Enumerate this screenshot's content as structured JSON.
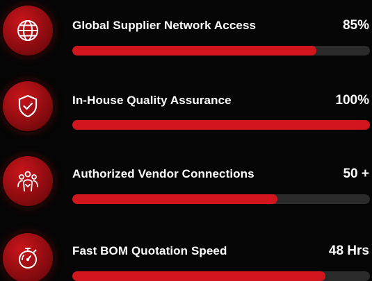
{
  "colors": {
    "accent": "#d0161c",
    "track": "#2a2a2a",
    "background": "#050505",
    "text": "#ffffff"
  },
  "metrics": [
    {
      "label": "Global Supplier Network Access",
      "value": "85%",
      "progress": 0.82,
      "icon": "globe-icon"
    },
    {
      "label": "In-House Quality Assurance",
      "value": "100%",
      "progress": 1.0,
      "icon": "shield-check-icon"
    },
    {
      "label": "Authorized Vendor Connections",
      "value": "50 +",
      "progress": 0.69,
      "icon": "team-icon"
    },
    {
      "label": "Fast BOM Quotation Speed",
      "value": "48 Hrs",
      "progress": 0.85,
      "icon": "stopwatch-icon"
    }
  ]
}
